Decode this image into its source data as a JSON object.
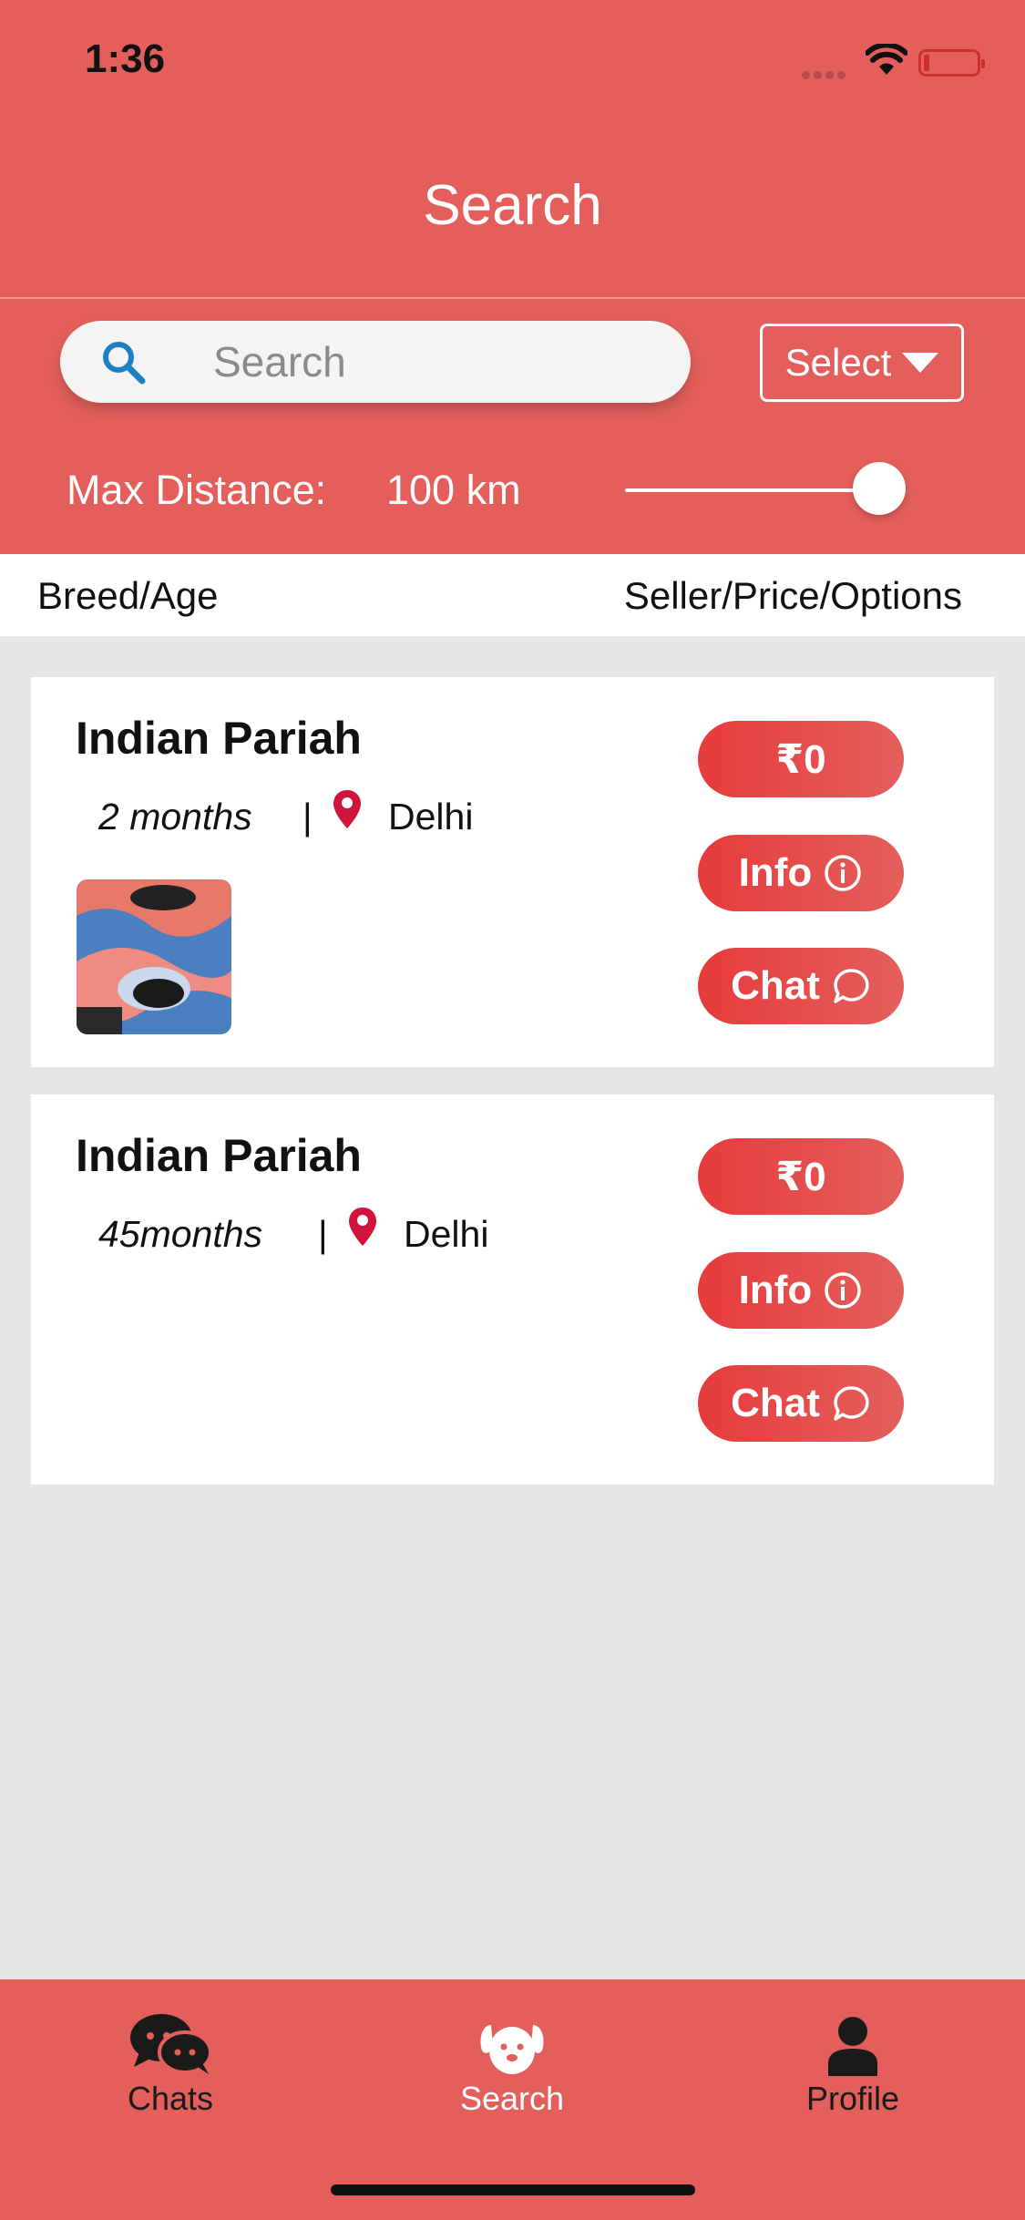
{
  "status_bar": {
    "time": "1:36"
  },
  "nav": {
    "title": "Search"
  },
  "search": {
    "placeholder": "Search",
    "select_label": "Select"
  },
  "distance": {
    "label": "Max Distance:",
    "value": "100 km",
    "slider_fraction": 1.0
  },
  "columns": {
    "left": "Breed/Age",
    "right": "Seller/Price/Options"
  },
  "listings": [
    {
      "breed": "Indian Pariah",
      "age": "2 months",
      "separator": "|",
      "city": "Delhi",
      "price": "₹0",
      "info_label": "Info",
      "chat_label": "Chat",
      "has_photo": true
    },
    {
      "breed": "Indian Pariah",
      "age": "45months",
      "separator": "|",
      "city": "Delhi",
      "price": "₹0",
      "info_label": "Info",
      "chat_label": "Chat",
      "has_photo": false
    }
  ],
  "tabs": [
    {
      "label": "Chats",
      "icon": "chat-bubbles-icon"
    },
    {
      "label": "Search",
      "icon": "dog-face-icon",
      "active": true
    },
    {
      "label": "Profile",
      "icon": "person-icon"
    }
  ],
  "colors": {
    "accent": "#e45f5c",
    "button": "#e53b3b",
    "pin": "#d0143c",
    "background": "#e6e6e6"
  }
}
